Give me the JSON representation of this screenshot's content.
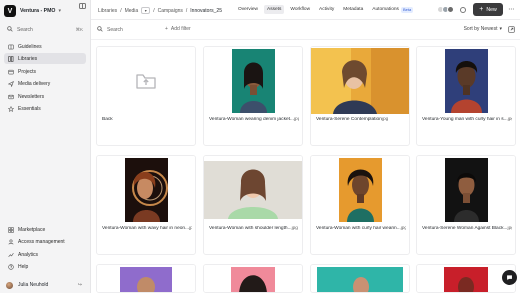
{
  "workspace": {
    "logo": "V",
    "name": "Ventura - PMO"
  },
  "sidebar": {
    "search_placeholder": "Search",
    "search_shortcut": "⌘K",
    "items": [
      {
        "label": "Guidelines",
        "icon": "book-icon"
      },
      {
        "label": "Libraries",
        "icon": "library-icon",
        "active": true
      },
      {
        "label": "Projects",
        "icon": "projects-icon"
      },
      {
        "label": "Media delivery",
        "icon": "delivery-icon"
      },
      {
        "label": "Newsletters",
        "icon": "newsletter-icon"
      },
      {
        "label": "Essentials",
        "icon": "essentials-icon"
      }
    ],
    "bottom_items": [
      {
        "label": "Marketplace",
        "icon": "marketplace-icon"
      },
      {
        "label": "Access management",
        "icon": "access-icon"
      },
      {
        "label": "Analytics",
        "icon": "analytics-icon"
      },
      {
        "label": "Help",
        "icon": "help-icon"
      }
    ],
    "user": {
      "name": "Julia Neuhold"
    }
  },
  "breadcrumb": [
    "Libraries",
    "Media",
    "Campaigns",
    "Innovators_25"
  ],
  "tabs": [
    {
      "label": "Overview"
    },
    {
      "label": "Assets",
      "active": true
    },
    {
      "label": "Workflow"
    },
    {
      "label": "Activity"
    },
    {
      "label": "Metadata"
    },
    {
      "label": "Automations",
      "badge": "Beta"
    }
  ],
  "new_button": "New",
  "toolbar": {
    "search_placeholder": "Search",
    "add_filter": "Add filter",
    "sort": "Sort by Newest"
  },
  "assets": [
    {
      "name": "Back",
      "ext": "",
      "type": "folder"
    },
    {
      "name": "Ventura-Woman wearing denim jacket...",
      "ext": "jpg"
    },
    {
      "name": "Ventura-Serene Contemplation",
      "ext": "jpg"
    },
    {
      "name": "Ventura-Young man with curly hair in s...",
      "ext": "jpg"
    },
    {
      "name": "Ventura-Woman with wavy hair in neon...",
      "ext": "jpg"
    },
    {
      "name": "Ventura-Woman with shoulder length...",
      "ext": "jpg"
    },
    {
      "name": "Ventura-Woman with curly hair wearin...",
      "ext": "jpg"
    },
    {
      "name": "Ventura-Serene Woman Against Black...",
      "ext": "jpg"
    }
  ],
  "colors": {
    "accent": "#3a3a3c",
    "sidebar_bg": "#f4f4f5",
    "beta": "#3a62d6"
  }
}
